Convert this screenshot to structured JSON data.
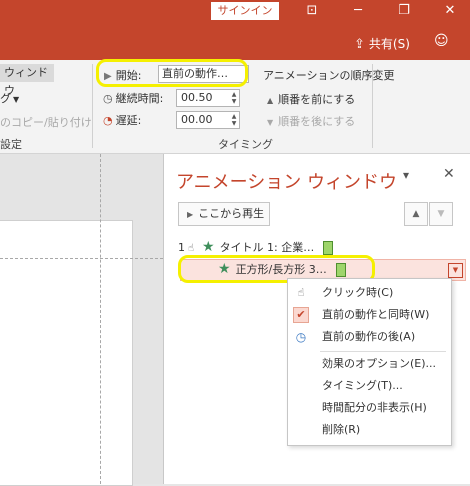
{
  "titlebar": {
    "signin_label": "サインイン",
    "share_label": "共有(S)",
    "controls": [
      "ribbon-display-icon",
      "minimize-icon",
      "restore-icon",
      "close-icon"
    ]
  },
  "ribbon": {
    "window_label": "ウィンドウ",
    "partial_dropdown_label": "グ",
    "copy_paste_label": "のコピー/貼り付け",
    "settings_group_label": "設定",
    "start_label": "開始:",
    "start_value": "直前の動作…",
    "duration_label": "継続時間:",
    "duration_value": "00.50",
    "delay_label": "遅延:",
    "delay_value": "00.00",
    "reorder_title": "アニメーションの順序変更",
    "move_earlier": "順番を前にする",
    "move_later": "順番を後にする",
    "timing_group_label": "タイミング"
  },
  "pane": {
    "title": "アニメーション ウィンドウ",
    "play_from_label": "ここから再生",
    "rows": [
      {
        "number": "1",
        "label": "タイトル 1: 企業…"
      },
      {
        "number": "",
        "label": "正方形/長方形 3…"
      }
    ]
  },
  "context_menu": {
    "items": [
      {
        "label": "クリック時(C)",
        "icon": "mouse-icon"
      },
      {
        "label": "直前の動作と同時(W)",
        "icon": "check-icon"
      },
      {
        "label": "直前の動作の後(A)",
        "icon": "clock-icon"
      },
      {
        "label": "効果のオプション(E)...",
        "icon": ""
      },
      {
        "label": "タイミング(T)...",
        "icon": ""
      },
      {
        "label": "時間配分の非表示(H)",
        "icon": ""
      },
      {
        "label": "削除(R)",
        "icon": ""
      }
    ]
  },
  "colors": {
    "accent": "#c4452c",
    "highlight_ring": "#f5f000",
    "selection": "#fbe3de",
    "timeline_bar": "#9ed56b"
  }
}
